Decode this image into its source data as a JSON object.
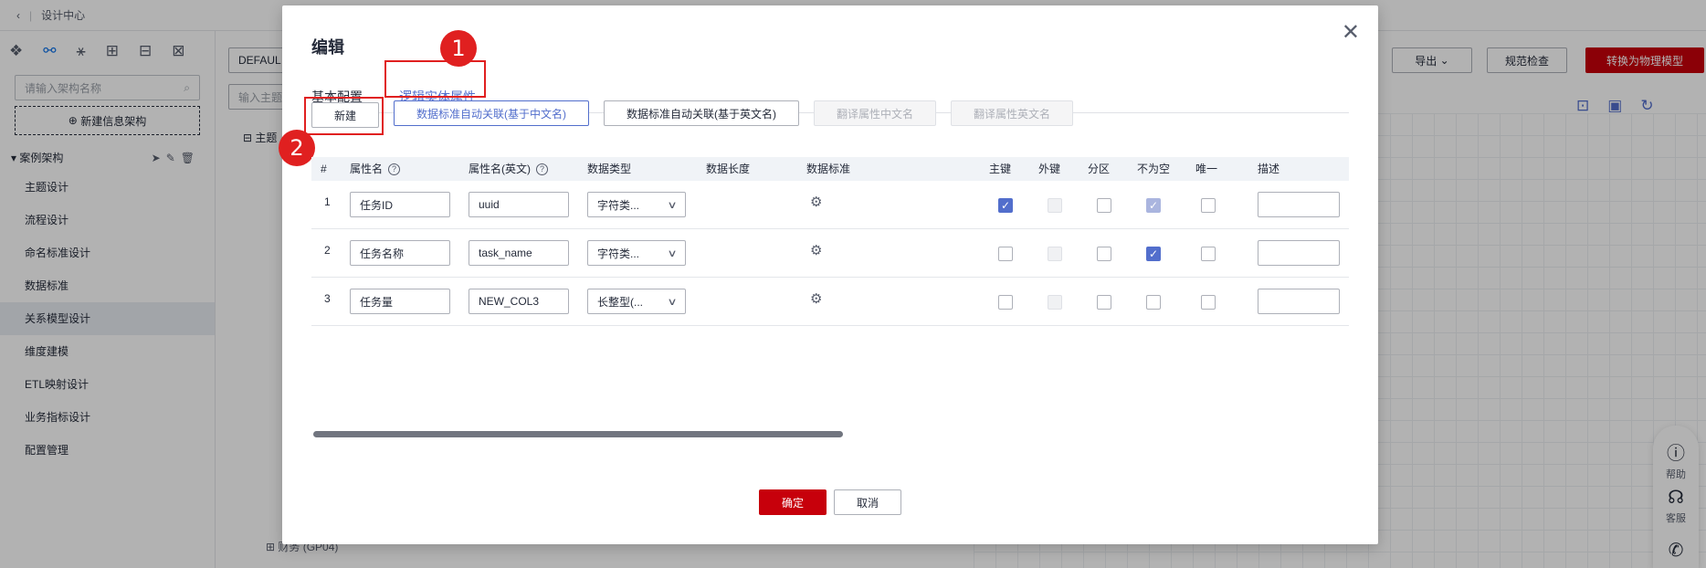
{
  "background": {
    "breadcrumb": "设计中心",
    "sidebar": {
      "search_placeholder": "请输入架构名称",
      "new_button": "新建信息架构",
      "group_label": "案例架构",
      "items": [
        "主题设计",
        "流程设计",
        "命名标准设计",
        "数据标准",
        "关系模型设计",
        "维度建模",
        "ETL映射设计",
        "业务指标设计",
        "配置管理"
      ],
      "active_index": 4
    },
    "toolbar": {
      "selector_value": "DEFAUL",
      "theme_input": "输入主题",
      "tree_root": "主题",
      "tree_leaf": "财务 (GP04)",
      "export_label": "导出",
      "check_label": "规范检查",
      "convert_label": "转换为物理模型"
    },
    "help_float": {
      "help": "帮助",
      "service": "客服"
    }
  },
  "dialog": {
    "title": "编辑",
    "tabs": [
      {
        "label": "基本配置",
        "active": false
      },
      {
        "label": "逻辑实体属性",
        "active": true
      }
    ],
    "badges": [
      "1",
      "2"
    ],
    "buttons": {
      "new": "新建",
      "auto_cn": "数据标准自动关联(基于中文名)",
      "auto_en": "数据标准自动关联(基于英文名)",
      "translate_cn": "翻译属性中文名",
      "translate_en": "翻译属性英文名"
    },
    "columns": {
      "num": "#",
      "name": "属性名",
      "name_en": "属性名(英文)",
      "type": "数据类型",
      "length": "数据长度",
      "standard": "数据标准",
      "pk": "主键",
      "fk": "外键",
      "partition": "分区",
      "not_null": "不为空",
      "unique": "唯一",
      "desc": "描述"
    },
    "rows": [
      {
        "num": "1",
        "name": "任务ID",
        "name_en": "uuid",
        "type": "字符类...",
        "pk": true,
        "fk": false,
        "partition": false,
        "not_null": true,
        "not_null_disabled": true,
        "unique": false
      },
      {
        "num": "2",
        "name": "任务名称",
        "name_en": "task_name",
        "type": "字符类...",
        "pk": false,
        "fk": false,
        "partition": false,
        "not_null": true,
        "not_null_disabled": false,
        "unique": false
      },
      {
        "num": "3",
        "name": "任务量",
        "name_en": "NEW_COL3",
        "type": "长整型(...",
        "pk": false,
        "fk": false,
        "partition": false,
        "not_null": false,
        "not_null_disabled": false,
        "unique": false
      }
    ],
    "footer": {
      "ok": "确定",
      "cancel": "取消"
    },
    "close_icon": "close-icon"
  }
}
